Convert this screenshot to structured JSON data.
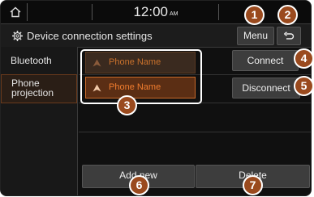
{
  "status_bar": {
    "time": "12:00",
    "ampm": "AM"
  },
  "header": {
    "title": "Device connection settings",
    "menu_label": "Menu"
  },
  "sidebar": {
    "items": [
      {
        "label": "Bluetooth"
      },
      {
        "label": "Phone projection"
      }
    ]
  },
  "devices": [
    {
      "name": "Phone Name"
    },
    {
      "name": "Phone Name"
    }
  ],
  "actions": {
    "connect_label": "Connect",
    "disconnect_label": "Disconnect",
    "add_new_label": "Add new",
    "delete_label": "Delete"
  },
  "callouts": [
    "1",
    "2",
    "3",
    "4",
    "5",
    "6",
    "7"
  ],
  "colors": {
    "accent": "#c96a2a",
    "callout": "#9a4a1e"
  },
  "icons": [
    "home-icon",
    "settings-gear-icon",
    "back-arrow-icon",
    "phone-projection-icon"
  ]
}
